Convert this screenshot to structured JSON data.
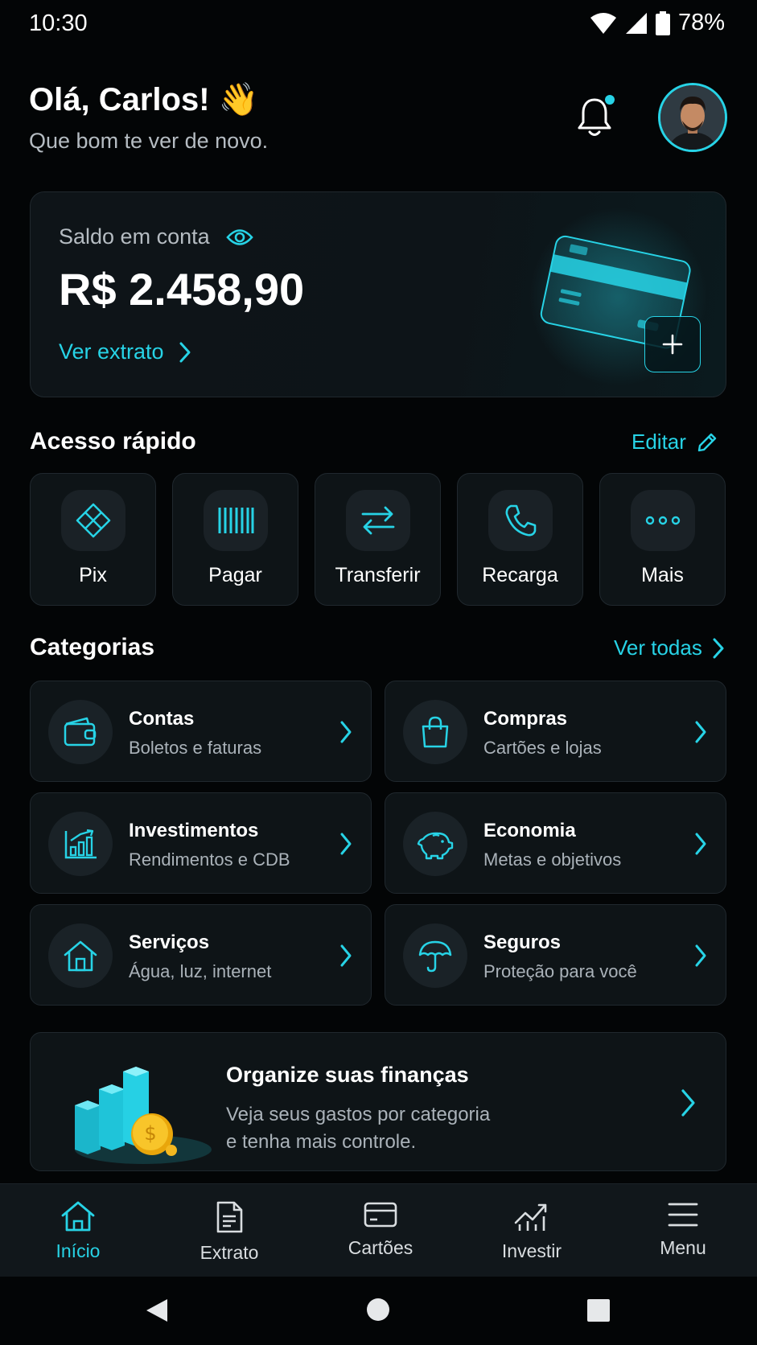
{
  "status": {
    "time": "10:30",
    "battery": "78%"
  },
  "header": {
    "greeting": "Olá, Carlos! 👋",
    "subtitle": "Que bom te ver de novo."
  },
  "balance": {
    "label": "Saldo em conta",
    "value": "R$ 2.458,90",
    "link": "Ver extrato"
  },
  "quick_access": {
    "title": "Acesso rápido",
    "edit": "Editar",
    "items": [
      {
        "label": "Pix",
        "icon": "pix-icon"
      },
      {
        "label": "Pagar",
        "icon": "barcode-icon"
      },
      {
        "label": "Transferir",
        "icon": "transfer-icon"
      },
      {
        "label": "Recarga",
        "icon": "phone-icon"
      },
      {
        "label": "Mais",
        "icon": "more-icon"
      }
    ]
  },
  "categories": {
    "title": "Categorias",
    "see_all": "Ver todas",
    "items": [
      {
        "title": "Contas",
        "subtitle": "Boletos e faturas",
        "icon": "wallet-icon"
      },
      {
        "title": "Compras",
        "subtitle": "Cartões e lojas",
        "icon": "shopping-bag-icon"
      },
      {
        "title": "Investimentos",
        "subtitle": "Rendimentos e CDB",
        "icon": "chart-bars-icon"
      },
      {
        "title": "Economia",
        "subtitle": "Metas e objetivos",
        "icon": "piggy-bank-icon"
      },
      {
        "title": "Serviços",
        "subtitle": "Água, luz, internet",
        "icon": "house-icon"
      },
      {
        "title": "Seguros",
        "subtitle": "Proteção para você",
        "icon": "umbrella-icon"
      }
    ]
  },
  "promo": {
    "title": "Organize suas finanças",
    "line1": "Veja seus gastos por categoria",
    "line2": "e tenha mais controle."
  },
  "nav": {
    "items": [
      {
        "label": "Início",
        "active": true
      },
      {
        "label": "Extrato"
      },
      {
        "label": "Cartões"
      },
      {
        "label": "Investir"
      },
      {
        "label": "Menu"
      }
    ]
  },
  "colors": {
    "accent": "#27d3e6",
    "background": "#030506",
    "card": "#0e1417"
  }
}
